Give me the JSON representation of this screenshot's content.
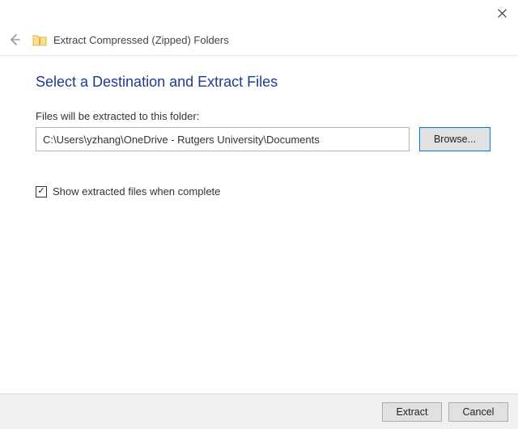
{
  "window": {
    "title": "Extract Compressed (Zipped) Folders"
  },
  "main": {
    "heading": "Select a Destination and Extract Files",
    "field_label": "Files will be extracted to this folder:",
    "path_value": "C:\\Users\\yzhang\\OneDrive - Rutgers University\\Documents",
    "browse_label": "Browse...",
    "checkbox_label": "Show extracted files when complete",
    "checkbox_checked": true
  },
  "footer": {
    "extract_label": "Extract",
    "cancel_label": "Cancel"
  }
}
